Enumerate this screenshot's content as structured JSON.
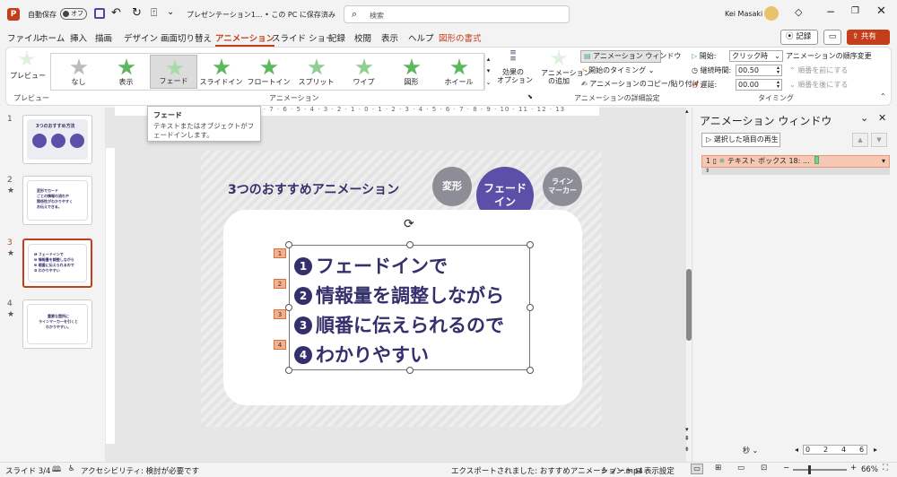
{
  "titlebar": {
    "autosave": "自動保存",
    "autosave_state": "オフ",
    "doc_title": "プレゼンテーション1... • この PC に保存済み",
    "search_placeholder": "検索",
    "user": "Kei Masaki"
  },
  "tabs": [
    "ファイル",
    "ホーム",
    "挿入",
    "描画",
    "デザイン",
    "画面切り替え",
    "アニメーション",
    "スライド ショー",
    "記録",
    "校閲",
    "表示",
    "ヘルプ",
    "図形の書式"
  ],
  "record_button": "記録",
  "share_button": "共有",
  "ribbon": {
    "preview": "プレビュー",
    "preview_group": "プレビュー",
    "animations": [
      "なし",
      "表示",
      "フェード",
      "スライドイン",
      "フロートイン",
      "スプリット",
      "ワイプ",
      "図形",
      "ホイール"
    ],
    "effect_options": "効果の\nオプション",
    "animation_group": "アニメーション",
    "add_animation": "アニメーション\nの追加",
    "anim_pane_btn": "アニメーション ウィンドウ",
    "trigger": "開始のタイミング",
    "painter": "アニメーションのコピー/貼り付け",
    "advanced_group": "アニメーションの詳細設定",
    "start_label": "開始:",
    "start_value": "クリック時",
    "duration_label": "継続時間:",
    "duration_value": "00.50",
    "delay_label": "遅延:",
    "delay_value": "00.00",
    "timing_group": "タイミング",
    "reorder_title": "アニメーションの順序変更",
    "move_earlier": "順番を前にする",
    "move_later": "順番を後にする"
  },
  "tooltip": {
    "title": "フェード",
    "body": "テキストまたはオブジェクトがフェードインします。"
  },
  "ruler_h": "9 · 8 · 7 · 6 · 5 · 4 · 3 · 2 · 1 · 0 · 1 · 2 · 3 · 4 · 5 · 6 · 7 · 8 · 9 · 10 · 11 · 12 · 13",
  "slides": [
    {
      "num": "1",
      "title": "3つのおすすめ方法"
    },
    {
      "num": "2",
      "text": "変形でカード\nごとの情報の流れや\n関係性がわかりやすく\nお伝えできる。"
    },
    {
      "num": "3",
      "text": "❶ フェードインで\n❷ 情報量を調整しながら\n❸ 順番に伝えられるので\n❹ わかりやすい"
    },
    {
      "num": "4",
      "text": "重要な箇所に\nラインマーカーを引くと\nわかりやすい。"
    }
  ],
  "slide": {
    "title": "3つのおすすめアニメーション",
    "circle1": "変形",
    "circle2": "フェード\nイン",
    "circle3": "ライン\nマーカー",
    "lines": [
      {
        "num": "1",
        "text": "フェードインで"
      },
      {
        "num": "2",
        "text": "情報量を調整しながら"
      },
      {
        "num": "3",
        "text": "順番に伝えられるので"
      },
      {
        "num": "4",
        "text": "わかりやすい"
      }
    ],
    "markers": [
      "1",
      "2",
      "3",
      "4"
    ]
  },
  "animpane": {
    "title": "アニメーション ウィンドウ",
    "play": "選択した項目の再生",
    "item_num": "1",
    "item_label": "テキスト ボックス 18: ...",
    "seconds": "秒",
    "timeline": [
      "0",
      "2",
      "4",
      "6"
    ]
  },
  "status": {
    "slide": "スライド 3/4",
    "accessibility": "アクセシビリティ: 検討が必要です",
    "export": "エクスポートされました: おすすめアニメーション.mp4",
    "notes": "ノート",
    "display": "表示設定",
    "zoom": "66%"
  },
  "colors": {
    "accent": "#c43e1c",
    "purple": "#5b4fa8",
    "navy": "#33306b",
    "star": "#5cb85c"
  }
}
